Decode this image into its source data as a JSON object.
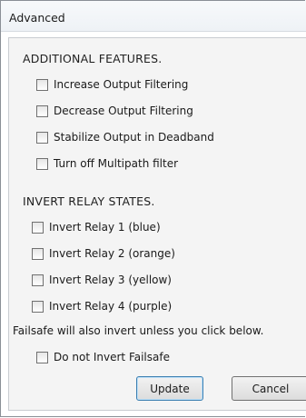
{
  "window": {
    "title": "Advanced"
  },
  "additional_features": {
    "heading": "ADDITIONAL FEATURES.",
    "options": [
      {
        "label": "Increase Output Filtering",
        "checked": false
      },
      {
        "label": "Decrease Output Filtering",
        "checked": false
      },
      {
        "label": "Stabilize Output in Deadband",
        "checked": false
      },
      {
        "label": "Turn off Multipath filter",
        "checked": false
      }
    ]
  },
  "invert_relay": {
    "heading": "INVERT RELAY STATES.",
    "options": [
      {
        "label": "Invert Relay 1 (blue)",
        "checked": false
      },
      {
        "label": "Invert Relay 2 (orange)",
        "checked": false
      },
      {
        "label": "Invert Relay 3 (yellow)",
        "checked": false
      },
      {
        "label": "Invert Relay 4 (purple)",
        "checked": false
      }
    ]
  },
  "failsafe": {
    "note": "Failsafe will also invert unless you click below.",
    "option": {
      "label": "Do not Invert Failsafe",
      "checked": false
    }
  },
  "buttons": {
    "update": "Update",
    "cancel": "Cancel"
  }
}
